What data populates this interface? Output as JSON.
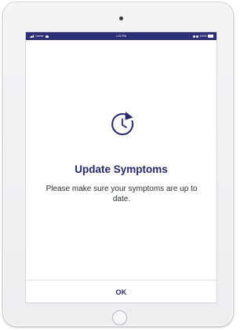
{
  "status_bar": {
    "carrier": "Carrier",
    "time": "1:20 PM",
    "right": "100%",
    "bg_color": "#2c2f73",
    "icons": [
      "signal-icon",
      "wifi-icon",
      "location-icon",
      "bluetooth-icon",
      "battery-icon"
    ]
  },
  "dialog": {
    "icon": "refresh-clock-icon",
    "title": "Update Symptoms",
    "message": "Please make sure your symptoms are up to date.",
    "button_label": "OK",
    "accent_color": "#27286b"
  },
  "device": {
    "icons": [
      "camera-icon",
      "home-button-icon"
    ]
  }
}
